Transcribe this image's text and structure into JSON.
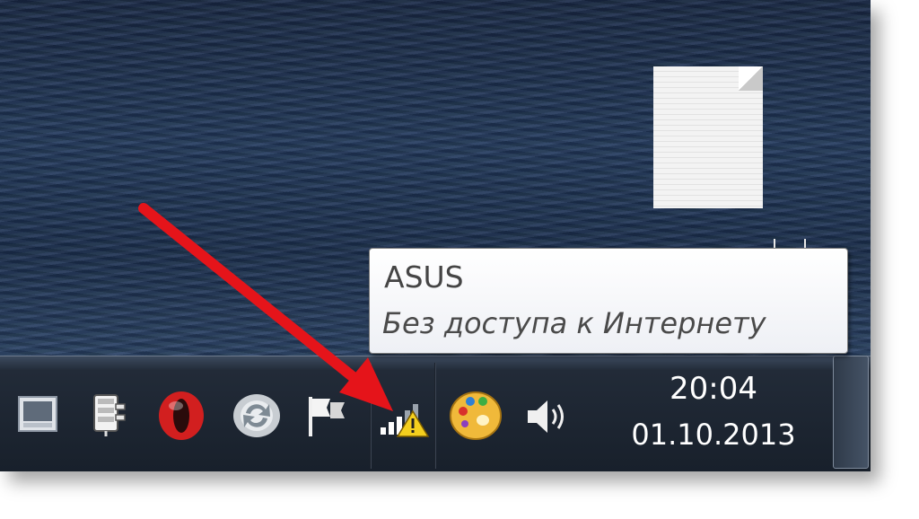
{
  "tooltip": {
    "title": "ASUS",
    "status": "Без доступа к Интернету"
  },
  "clock": {
    "time": "20:04",
    "date": "01.10.2013"
  },
  "tray_icons": [
    {
      "name": "action-center-icon"
    },
    {
      "name": "power-plug-icon"
    },
    {
      "name": "opera-icon"
    },
    {
      "name": "sync-icon"
    },
    {
      "name": "flag-icon"
    },
    {
      "name": "network-warning-icon"
    },
    {
      "name": "palette-icon"
    },
    {
      "name": "volume-icon"
    }
  ],
  "colors": {
    "arrow": "#e5141a",
    "opera": "#d21f1f",
    "warning": "#f4cf1e"
  }
}
